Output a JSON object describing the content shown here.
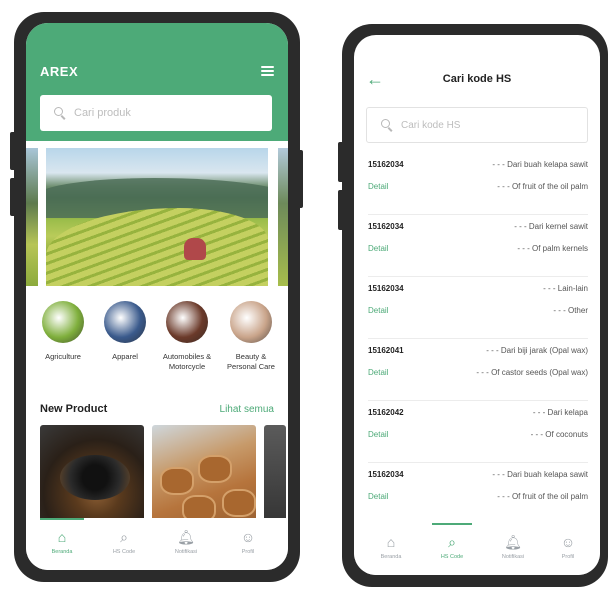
{
  "left_screen": {
    "brand": "AREX",
    "search_placeholder": "Cari produk",
    "categories": [
      {
        "label": "Agriculture",
        "color": "#7faf3c"
      },
      {
        "label": "Apparel",
        "color": "#3a5a8c"
      },
      {
        "label": "Automobiles & Motorcycle",
        "color": "#6b3a2a"
      },
      {
        "label": "Beauty & Personal Care",
        "color": "#c9a48a"
      }
    ],
    "new_product_title": "New Product",
    "see_all_link": "Lihat semua",
    "nav": [
      {
        "label": "Beranda",
        "icon": "home-icon",
        "glyph": "⌂",
        "active": true
      },
      {
        "label": "HS Code",
        "icon": "search-icon",
        "glyph": "⌕",
        "active": false
      },
      {
        "label": "Notifikasi",
        "icon": "bell-icon",
        "glyph": "🔔︎",
        "active": false
      },
      {
        "label": "Profil",
        "icon": "user-icon",
        "glyph": "☺",
        "active": false
      }
    ]
  },
  "right_screen": {
    "back_icon": "←",
    "title": "Cari kode HS",
    "search_placeholder": "Cari kode HS",
    "rows": [
      {
        "code": "15162034",
        "desc_id": "- - - Dari buah kelapa sawit",
        "detail": "Detail",
        "desc_en": "- - - Of fruit of the oil palm"
      },
      {
        "code": "15162034",
        "desc_id": "- - - Dari kernel sawit",
        "detail": "Detail",
        "desc_en": "- - - Of palm kernels"
      },
      {
        "code": "15162034",
        "desc_id": "- - - Lain-lain",
        "detail": "Detail",
        "desc_en": "- - - Other"
      },
      {
        "code": "15162041",
        "desc_id": "- - - Dari biji jarak (Opal wax)",
        "detail": "Detail",
        "desc_en": "- - - Of castor seeds (Opal wax)"
      },
      {
        "code": "15162042",
        "desc_id": "- - - Dari kelapa",
        "detail": "Detail",
        "desc_en": "- - - Of coconuts"
      },
      {
        "code": "15162034",
        "desc_id": "- - - Dari buah kelapa sawit",
        "detail": "Detail",
        "desc_en": "- - - Of fruit of the oil palm"
      }
    ],
    "nav": [
      {
        "label": "Beranda",
        "icon": "home-icon",
        "glyph": "⌂",
        "active": false
      },
      {
        "label": "HS Code",
        "icon": "search-icon",
        "glyph": "⌕",
        "active": true
      },
      {
        "label": "Notifikasi",
        "icon": "bell-icon",
        "glyph": "🔔︎",
        "active": false
      },
      {
        "label": "Profil",
        "icon": "user-icon",
        "glyph": "☺",
        "active": false
      }
    ]
  },
  "colors": {
    "accent": "#4daa78"
  }
}
